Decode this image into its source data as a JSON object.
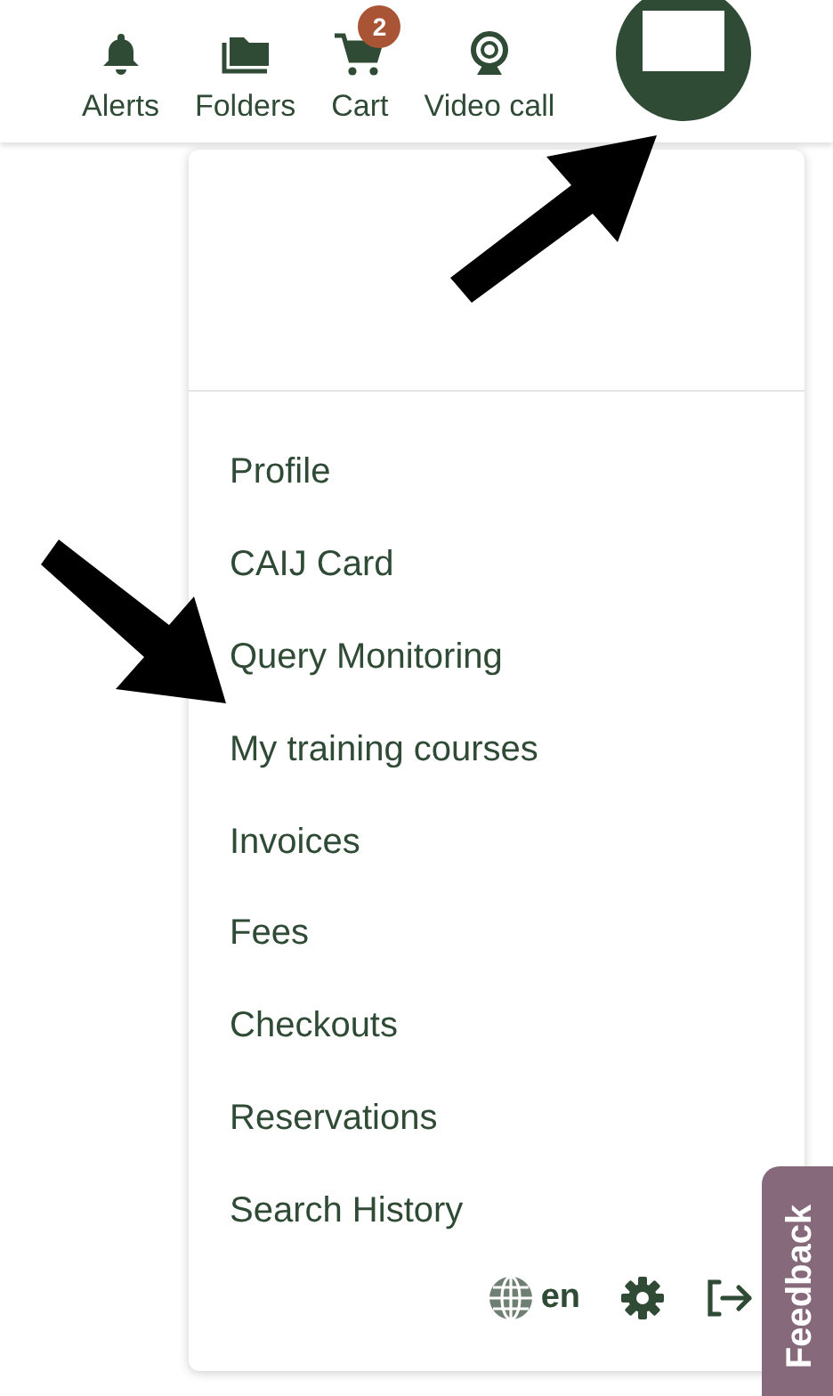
{
  "nav": [
    {
      "label": "Alerts"
    },
    {
      "label": "Folders"
    },
    {
      "label": "Cart",
      "badge": "2"
    },
    {
      "label": "Video call"
    }
  ],
  "menu": {
    "items": [
      "Profile",
      "CAIJ Card",
      "Query Monitoring",
      "My training courses",
      "Invoices",
      "Fees",
      "Checkouts",
      "Reservations",
      "Search History"
    ],
    "language": "en"
  },
  "feedback": "Feedback"
}
